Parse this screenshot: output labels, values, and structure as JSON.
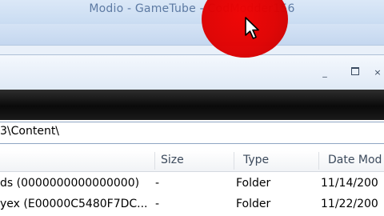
{
  "window": {
    "title": "Modio - GameTube - CodModder156"
  },
  "explorer": {
    "controls": {
      "minimize": "_",
      "maximize": "",
      "close": "×"
    },
    "address_text": "3\\Content\\"
  },
  "list": {
    "columns": [
      "Size",
      "Type",
      "Date Mod"
    ],
    "rows": [
      {
        "name": "ds (0000000000000000)",
        "size": "-",
        "type": "Folder",
        "date": "11/14/200"
      },
      {
        "name": "yex  (E00000C5480F7DC...",
        "size": "-",
        "type": "Folder",
        "date": "11/22/200"
      }
    ]
  },
  "cursor": {
    "highlight_color": "#e00000",
    "icon": "mouse-pointer-icon"
  }
}
